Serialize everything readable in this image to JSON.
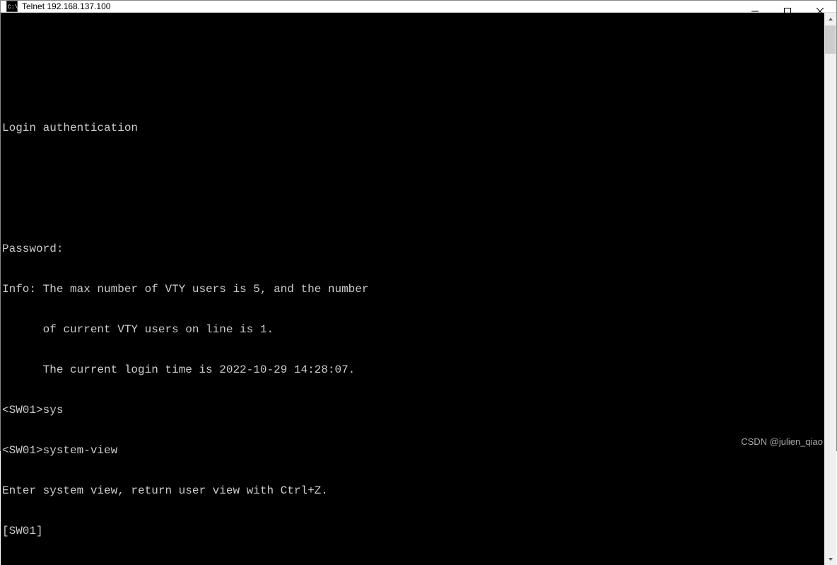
{
  "window": {
    "title": "Telnet 192.168.137.100"
  },
  "terminal": {
    "lines": [
      "",
      "",
      "Login authentication",
      "",
      "",
      "Password:",
      "Info: The max number of VTY users is 5, and the number",
      "      of current VTY users on line is 1.",
      "      The current login time is 2022-10-29 14:28:07.",
      "<SW01>sys",
      "<SW01>system-view",
      "Enter system view, return user view with Ctrl+Z.",
      "[SW01]"
    ]
  },
  "watermark": "CSDN @julien_qiao"
}
